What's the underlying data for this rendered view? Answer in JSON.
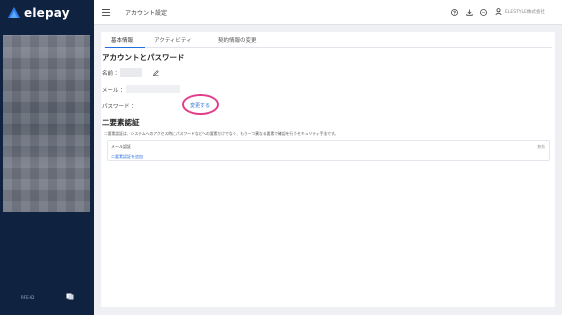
{
  "app": {
    "name": "elepay"
  },
  "header": {
    "title": "アカウント設定",
    "user_name": "ELESTYLE株式会社"
  },
  "tabs": [
    {
      "label": "基本情報",
      "active": true
    },
    {
      "label": "アクティビティ",
      "active": false
    },
    {
      "label": "契約情報の変更",
      "active": false
    }
  ],
  "account_section": {
    "title": "アカウントとパスワード",
    "name_label": "名前 ：",
    "email_label": "メール ：",
    "password_label": "パスワード ：",
    "change_link": "変更する"
  },
  "twofa_section": {
    "title": "二要素認証",
    "description": "二要素認証は、システムへのアクセス時にパスワードなどへの要素だけでなく、もう一つ異なる要素で確認を行うセキュリティ手法です。",
    "method_label": "メール認証",
    "status": "無効",
    "add_link": "二要素認証を追加"
  },
  "sidebar": {
    "footer_text": "RFE-ID"
  },
  "colors": {
    "sidebar_bg": "#0f2340",
    "accent": "#1e6fe0",
    "highlight": "#e23c8b",
    "link": "#2b6fd8"
  }
}
